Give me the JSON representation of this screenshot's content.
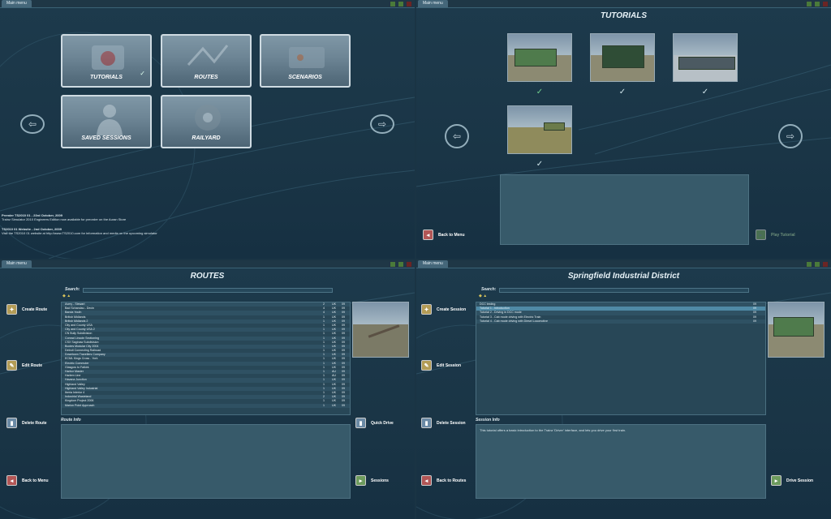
{
  "window": {
    "title": "Main menu"
  },
  "main_menu": {
    "tiles": [
      {
        "label": "TUTORIALS"
      },
      {
        "label": "ROUTES"
      },
      {
        "label": "SCENARIOS"
      },
      {
        "label": "SAVED SESSIONS"
      },
      {
        "label": "RAILYARD"
      }
    ],
    "news": [
      {
        "title": "Premier TS2010 01 - 23rd October, 2009",
        "body": "Trainz Simulator 2010 Engineers Edition now available for preorder on the Auran Store"
      },
      {
        "title": "TS2010 01 Website - 2nd October, 2009",
        "body": "Visit the TS2010 01 website at http://www.TS2010.com for information and media on the upcoming simulator"
      }
    ]
  },
  "tutorials": {
    "title": "TUTORIALS",
    "back_label": "Back to Menu",
    "play_label": "Play Tutorial",
    "checks": [
      true,
      false,
      false,
      false
    ]
  },
  "routes": {
    "title": "ROUTES",
    "search_label": "Search:",
    "buttons": {
      "create": "Create Route",
      "edit": "Edit Route",
      "delete": "Delete Route",
      "back": "Back to Menu",
      "quick_drive": "Quick Drive",
      "sessions": "Sessions"
    },
    "info_label": "Route Info",
    "rows": [
      {
        "name": "Avery - Stewart",
        "c1": "2",
        "c2": "UK",
        "c3": "09"
      },
      {
        "name": "Bad Schandau - Decin",
        "c1": "4",
        "c2": "UK",
        "c3": "09"
      },
      {
        "name": "Banda Youth",
        "c1": "4",
        "c2": "UK",
        "c3": "09"
      },
      {
        "name": "British Midlands",
        "c1": "1",
        "c2": "UK",
        "c3": "09"
      },
      {
        "name": "British Midlands 2",
        "c1": "1",
        "c2": "UK",
        "c3": "09"
      },
      {
        "name": "City and County USA",
        "c1": "1",
        "c2": "UK",
        "c3": "09"
      },
      {
        "name": "City and County USA 2",
        "c1": "1",
        "c2": "UK",
        "c3": "09"
      },
      {
        "name": "CN Bully Subdivision",
        "c1": "1",
        "c2": "UK",
        "c3": "09"
      },
      {
        "name": "Conrad Lincoln Sectioning",
        "c1": "1",
        "c2": "UK",
        "c3": "09"
      },
      {
        "name": "CSX Saginaw Subdivision",
        "c1": "1",
        "c2": "UK",
        "c3": "09"
      },
      {
        "name": "Bootes Modular City 2004",
        "c1": "1",
        "c2": "UK",
        "c3": "09"
      },
      {
        "name": "Detroit Connecting Railroad",
        "c1": "1",
        "c2": "UK",
        "c3": "09"
      },
      {
        "name": "Downtown Travellers Company",
        "c1": "1",
        "c2": "UK",
        "c3": "09"
      },
      {
        "name": "ECML Kings Cross - York",
        "c1": "1",
        "c2": "UK",
        "c3": "09"
      },
      {
        "name": "Electric Commuter",
        "c1": "1",
        "c2": "UK",
        "c3": "09"
      },
      {
        "name": "Glasgow to Falkirk",
        "c1": "1",
        "c2": "UK",
        "c3": "09"
      },
      {
        "name": "Harbor Master",
        "c1": "1",
        "c2": "AU",
        "c3": "09"
      },
      {
        "name": "Harlem Line",
        "c1": "1",
        "c2": "AU",
        "c3": "09"
      },
      {
        "name": "Havana Junction",
        "c1": "1",
        "c2": "UK",
        "c3": "09"
      },
      {
        "name": "Highland Valley",
        "c1": "1",
        "c2": "UK",
        "c3": "09"
      },
      {
        "name": "Highland Valley Industrial",
        "c1": "1",
        "c2": "UK",
        "c3": "09"
      },
      {
        "name": "Iberia Interior 4",
        "c1": "1",
        "c2": "UK",
        "c3": "09"
      },
      {
        "name": "Industrial Wasteland",
        "c1": "2",
        "c2": "UK",
        "c3": "09"
      },
      {
        "name": "Kingdom Project 2006",
        "c1": "1",
        "c2": "UK",
        "c3": "09"
      },
      {
        "name": "Marion Point Approach",
        "c1": "1",
        "c2": "UK",
        "c3": "09"
      }
    ]
  },
  "sessions": {
    "title": "Springfield Industrial District",
    "search_label": "Search:",
    "buttons": {
      "create": "Create Session",
      "edit": "Edit Session",
      "delete": "Delete Session",
      "back": "Back to Routes",
      "drive": "Drive Session"
    },
    "info_label": "Session Info",
    "info_text": "This tutorial offers a basic introduction to the Trainz 'Driver' interface, and lets you drive your first train.",
    "rows": [
      {
        "name": "DCC testing",
        "c1": "09"
      },
      {
        "name": "Tutorial 1 - Introduction",
        "c1": "09"
      },
      {
        "name": "Tutorial 2 - Driving in DCC mode",
        "c1": "09"
      },
      {
        "name": "Tutorial 3 - Cab mode driving with Electric Train",
        "c1": "09"
      },
      {
        "name": "Tutorial 4 - Cab mode driving with Diesel Locomotive",
        "c1": "09"
      }
    ]
  },
  "colors": {
    "bg": "#1d3a4c",
    "panel": "#375a6a",
    "accent": "#4f8aa6"
  }
}
